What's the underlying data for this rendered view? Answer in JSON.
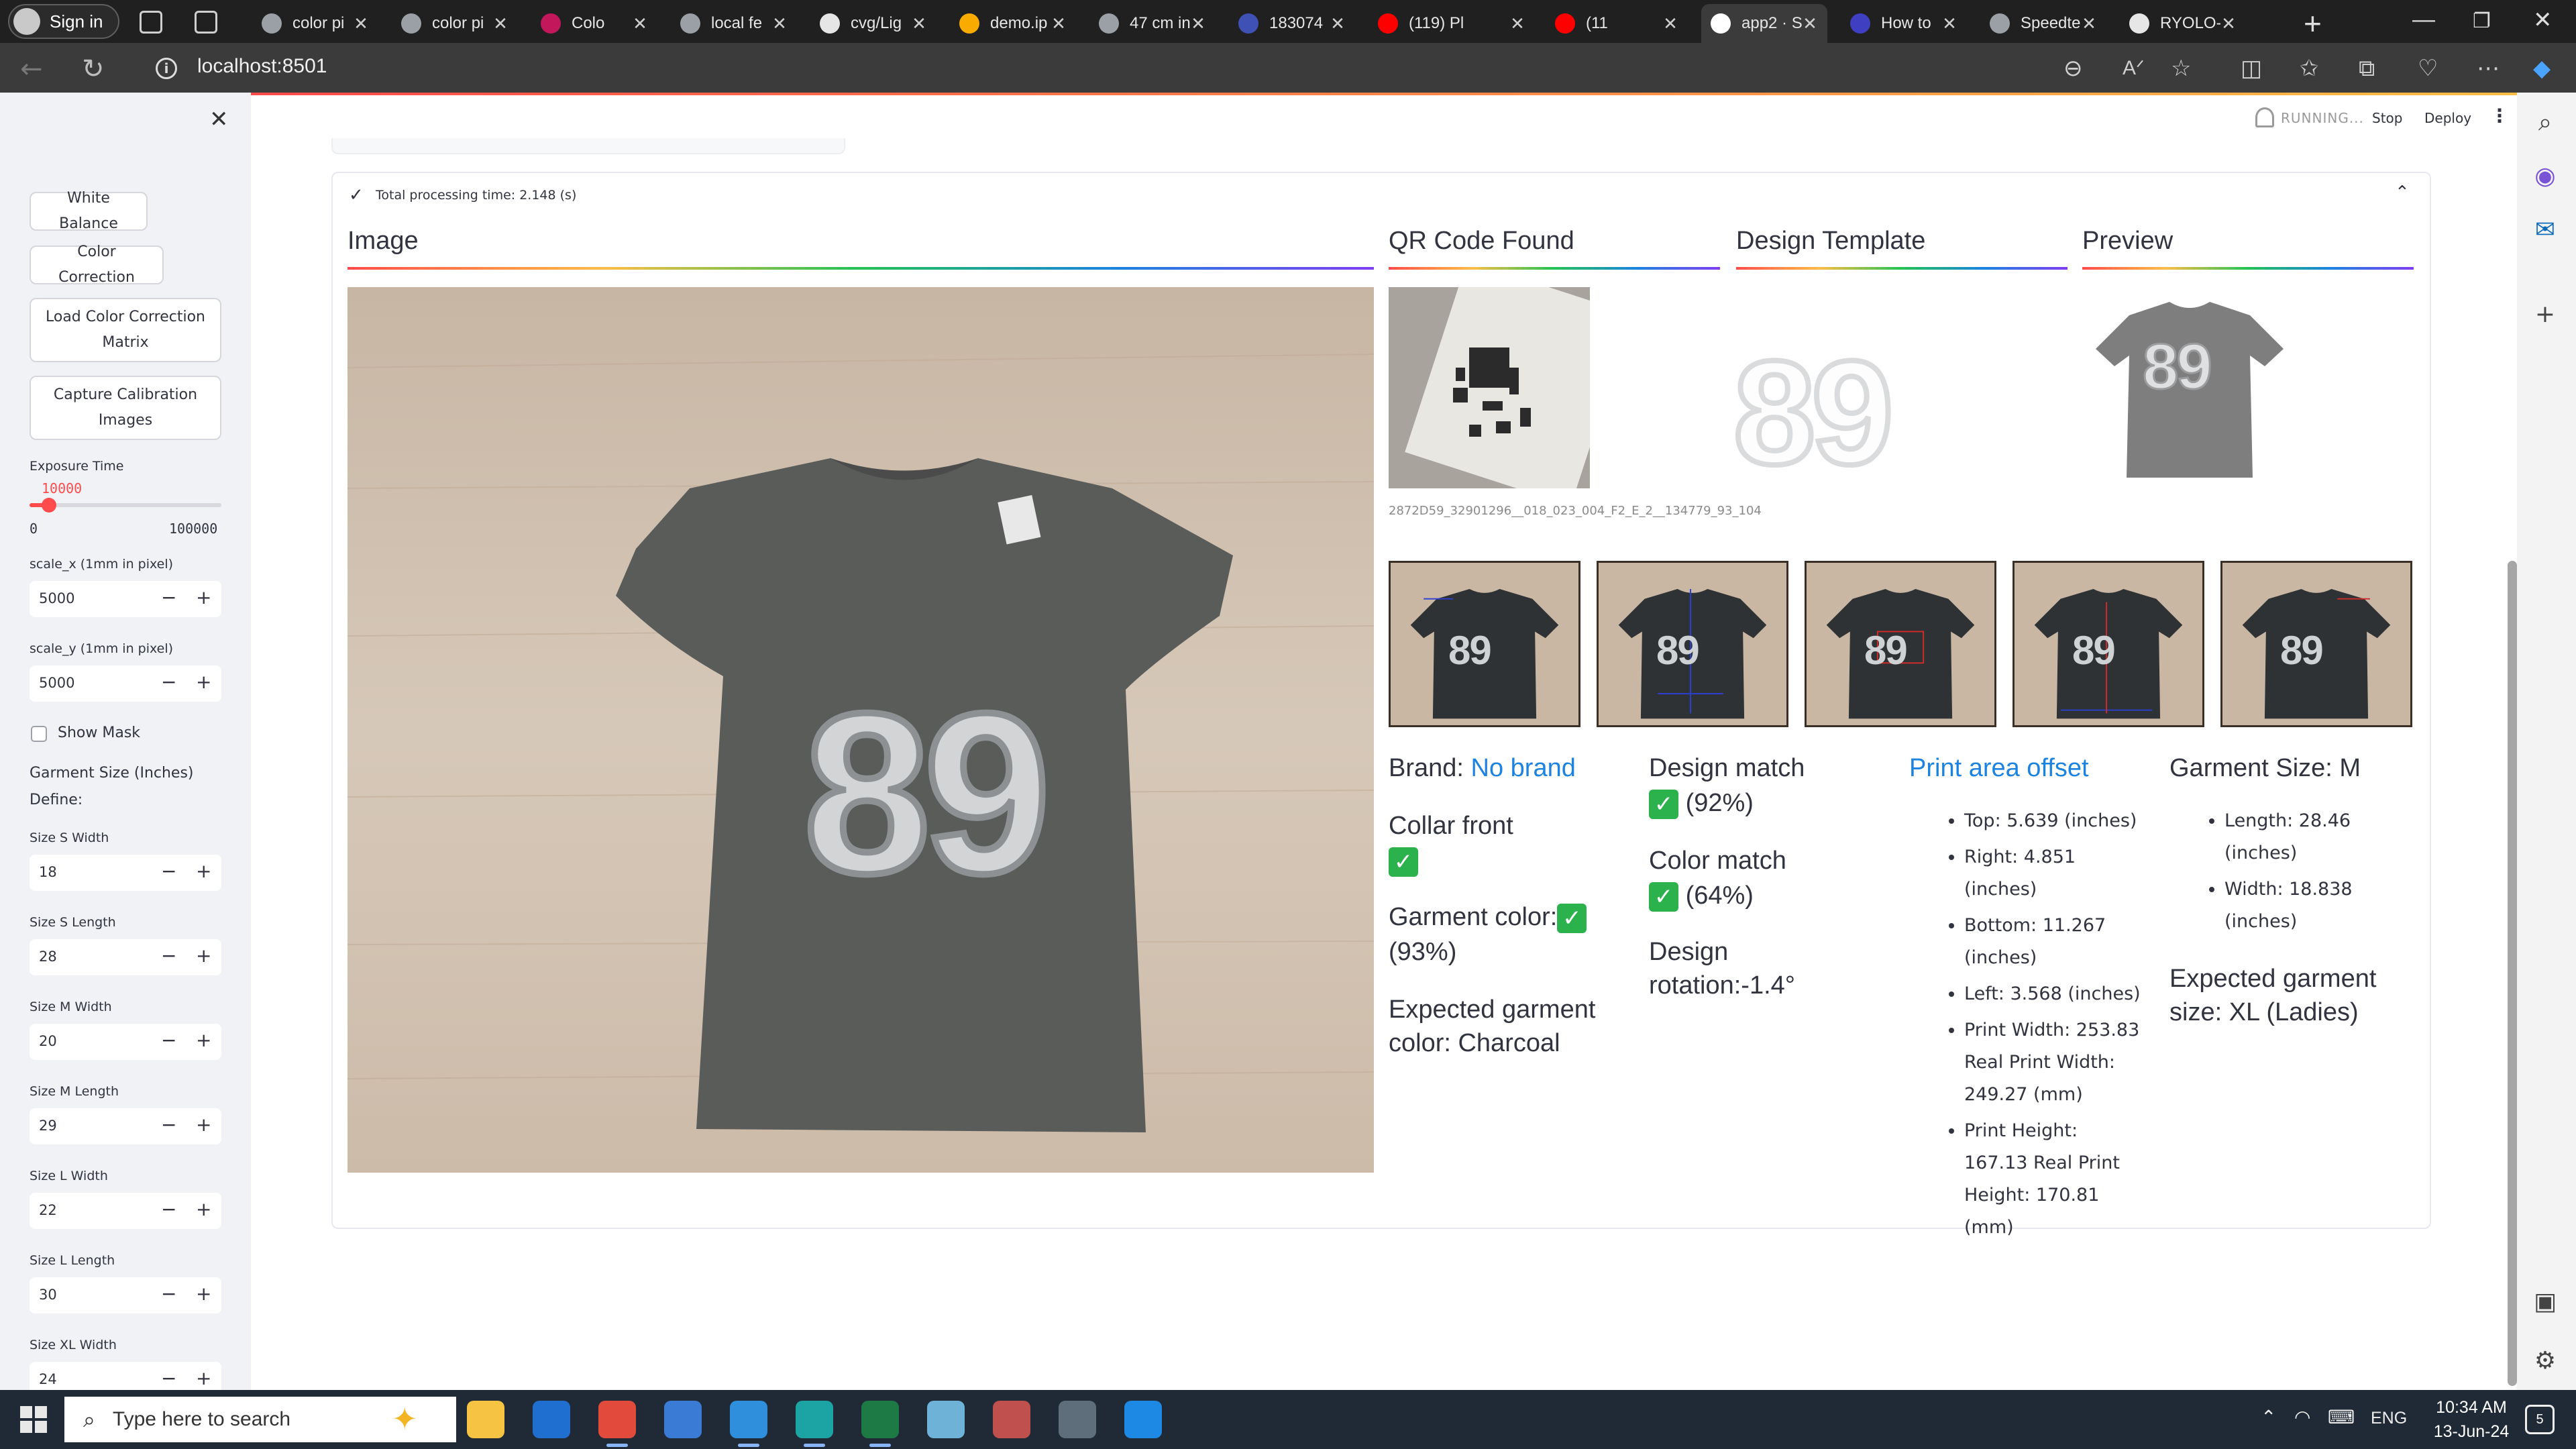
{
  "browser": {
    "signin_label": "Sign in",
    "tabs": [
      {
        "title": "color pi",
        "fav": "#9aa0a6"
      },
      {
        "title": "color pi",
        "fav": "#9aa0a6"
      },
      {
        "title": "Colo",
        "fav": "#c2185b"
      },
      {
        "title": "local fe",
        "fav": "#9aa0a6"
      },
      {
        "title": "cvg/Lig",
        "fav": "#e6e6e6"
      },
      {
        "title": "demo.ip",
        "fav": "#f9ab00"
      },
      {
        "title": "47 cm in",
        "fav": "#9aa0a6"
      },
      {
        "title": "183074",
        "fav": "#3f51b5"
      },
      {
        "title": "(119) Pl",
        "fav": "#ff0000"
      },
      {
        "title": "(11",
        "fav": "#ff0000"
      },
      {
        "title": "app2 · S",
        "fav": "#ffffff"
      },
      {
        "title": "How to",
        "fav": "#3f3fc2"
      },
      {
        "title": "Speedte",
        "fav": "#9aa0a6"
      },
      {
        "title": "RYOLO-",
        "fav": "#e6e6e6"
      }
    ],
    "url": "localhost:8501"
  },
  "sidebar": {
    "buttons": {
      "white_balance": "White Balance",
      "color_correction": "Color Correction",
      "load_ccm": "Load Color Correction Matrix",
      "capture_calibration": "Capture Calibration Images"
    },
    "exposure": {
      "label": "Exposure Time",
      "value": "10000",
      "min": "0",
      "max": "100000",
      "fraction": 0.1
    },
    "scale_x": {
      "label": "scale_x (1mm in pixel)",
      "value": "5000"
    },
    "scale_y": {
      "label": "scale_y (1mm in pixel)",
      "value": "5000"
    },
    "show_mask": "Show Mask",
    "garment_size_heading": "Garment Size (Inches)",
    "define_label": "Define:",
    "sizes": [
      {
        "label": "Size S Width",
        "value": "18"
      },
      {
        "label": "Size S Length",
        "value": "28"
      },
      {
        "label": "Size M Width",
        "value": "20"
      },
      {
        "label": "Size M Length",
        "value": "29"
      },
      {
        "label": "Size L Width",
        "value": "22"
      },
      {
        "label": "Size L Length",
        "value": "30"
      },
      {
        "label": "Size XL Width",
        "value": "24"
      }
    ]
  },
  "header": {
    "status": "RUNNING...",
    "stop": "Stop",
    "deploy": "Deploy"
  },
  "result": {
    "processing_time": "Total processing time: 2.148 (s)",
    "headings": {
      "image": "Image",
      "qr": "QR Code Found",
      "template": "Design Template",
      "preview": "Preview"
    },
    "qr_caption": "2872D59_32901296__018_023_004_F2_E_2__134779_93_104",
    "shirt_number": "89",
    "brand_label": "Brand:",
    "brand_value": "No brand",
    "collar_front": "Collar front",
    "garment_color": "Garment color:",
    "garment_color_pct": "(93%)",
    "expected_color": "Expected garment color: Charcoal",
    "design_match": "Design match",
    "design_match_pct": "(92%)",
    "color_match": "Color match",
    "color_match_pct": "(64%)",
    "design_rotation": "Design rotation:-1.4°",
    "print_area_title": "Print area offset",
    "print_area": [
      "Top: 5.639 (inches)",
      "Right: 4.851 (inches)",
      "Bottom: 11.267 (inches)",
      "Left: 3.568 (inches)",
      "Print Width: 253.83 Real Print Width: 249.27 (mm)",
      "Print Height: 167.13 Real Print Height: 170.81 (mm)"
    ],
    "garment_size_title": "Garment Size: M",
    "garment_size": [
      "Length: 28.46 (inches)",
      "Width: 18.838 (inches)"
    ],
    "expected_size": "Expected garment size: XL (Ladies)"
  },
  "taskbar": {
    "search_placeholder": "Type here to search",
    "lang": "ENG",
    "time": "10:34 AM",
    "date": "13-Jun-24",
    "notifications": "5"
  }
}
